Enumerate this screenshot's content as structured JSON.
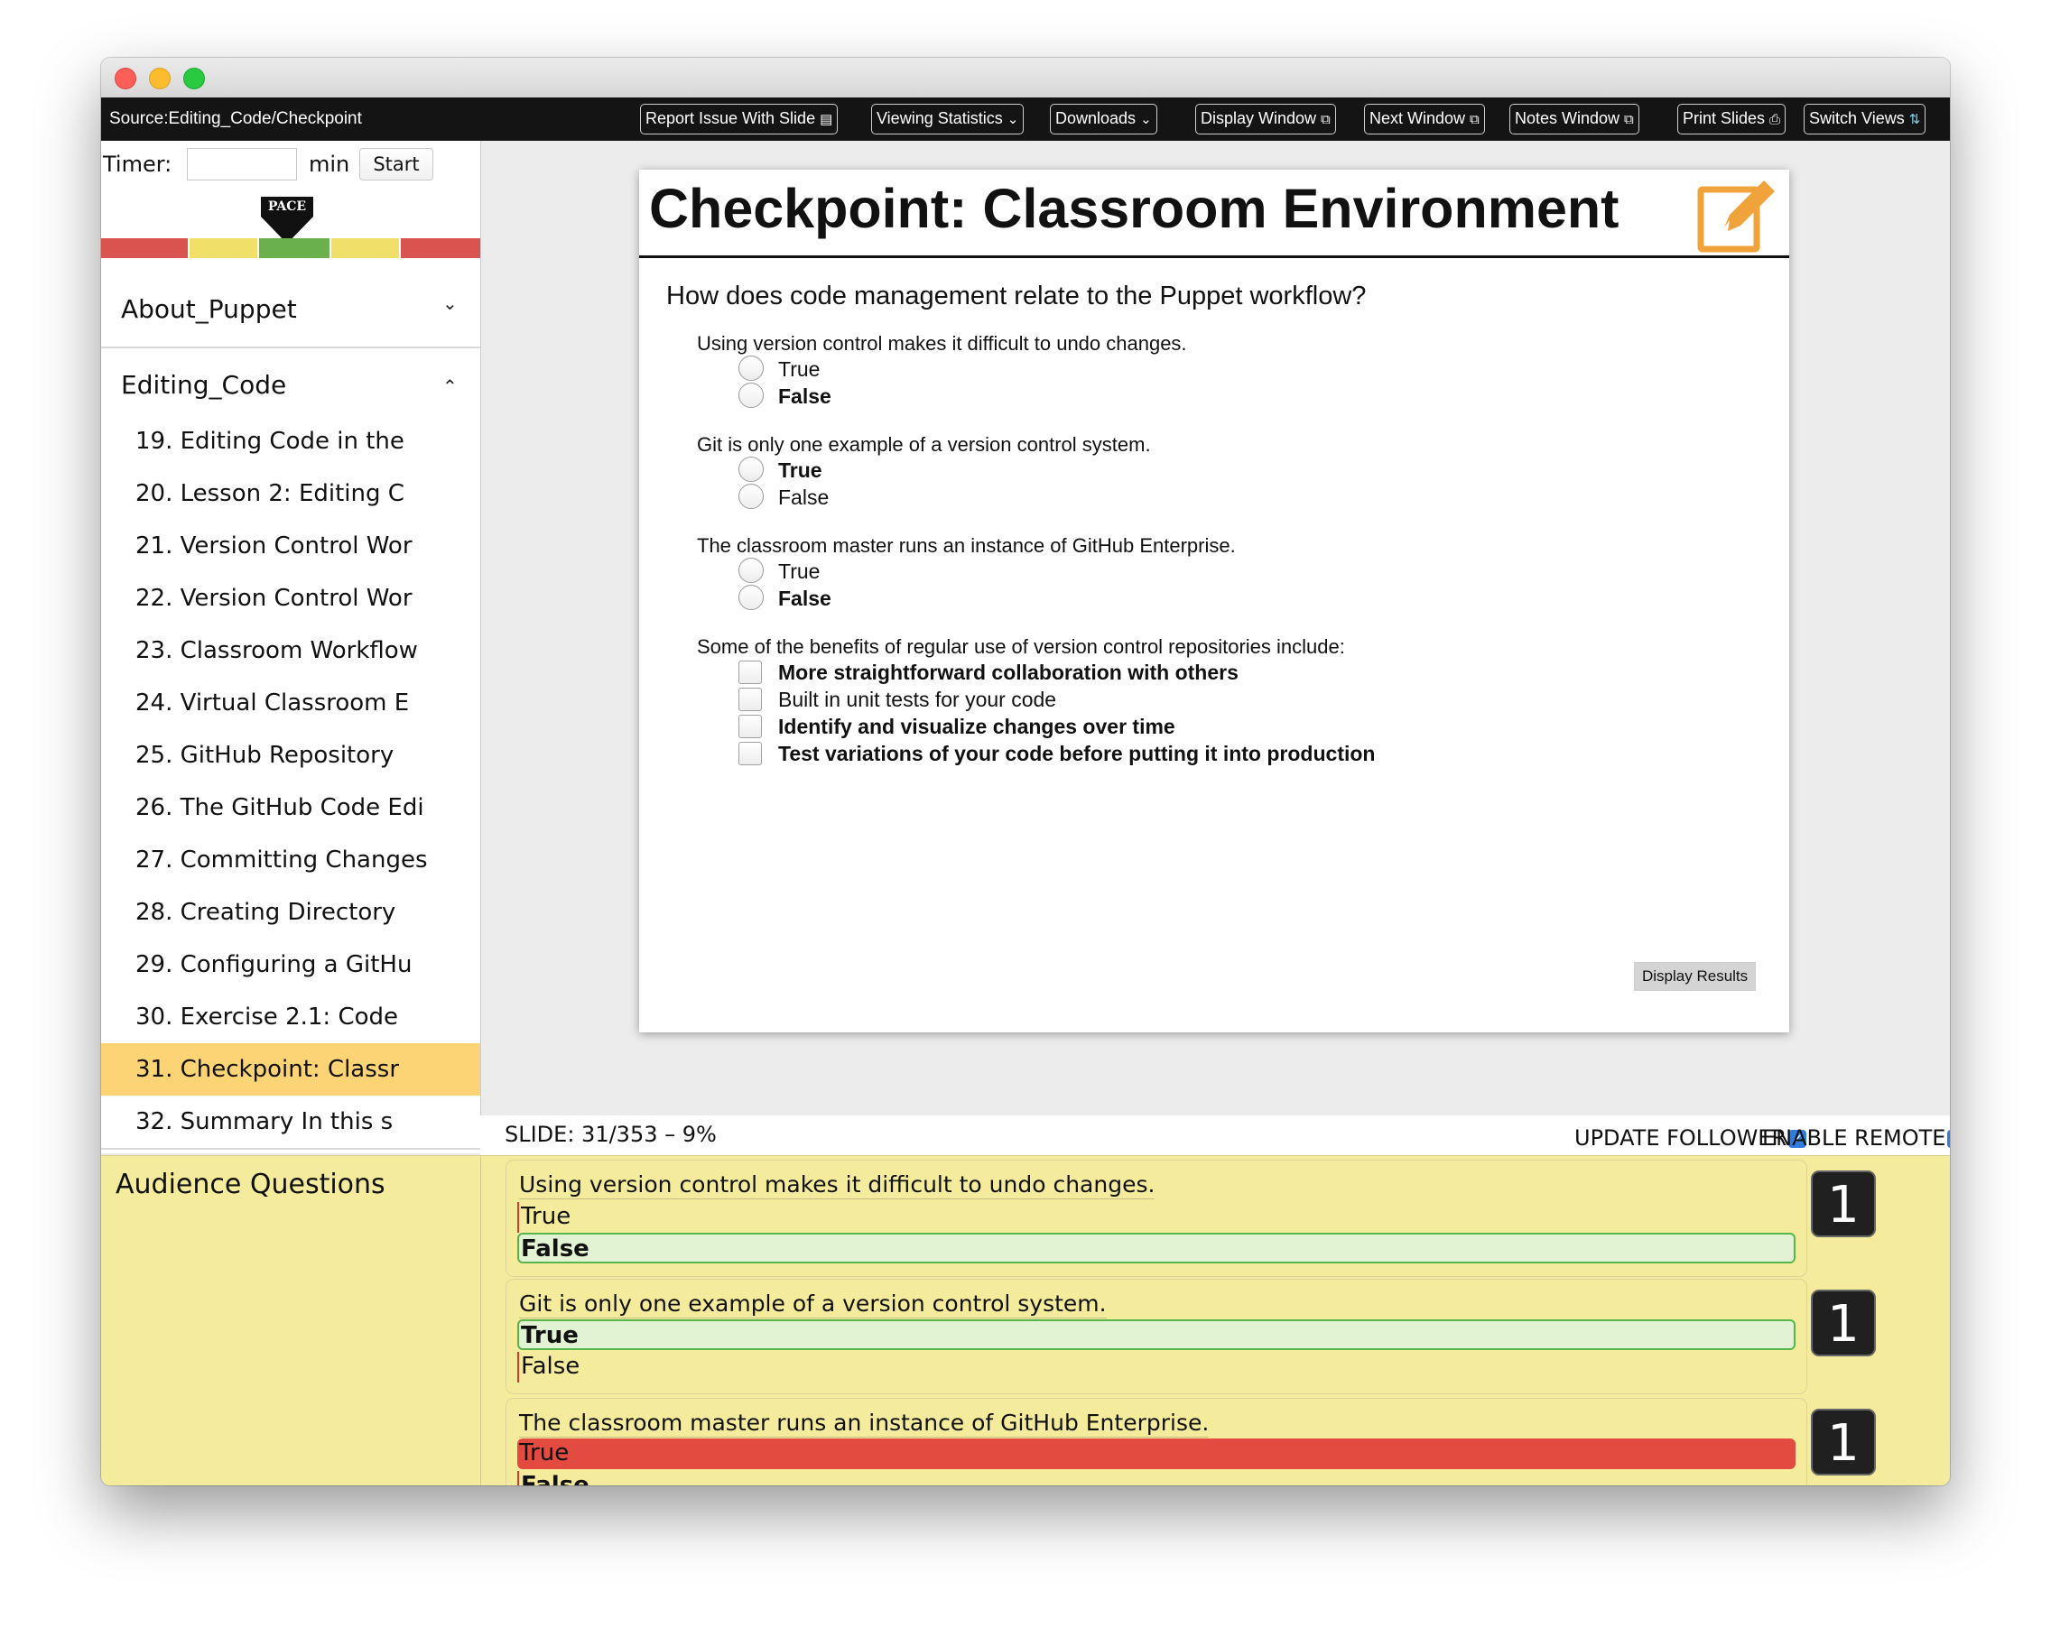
{
  "toolbar": {
    "source": "Source:Editing_Code/Checkpoint",
    "buttons": [
      {
        "label": "Report Issue With Slide",
        "icon": "▤"
      },
      {
        "label": "Viewing Statistics",
        "icon": "⌄"
      },
      {
        "label": "Downloads",
        "icon": "⌄"
      },
      {
        "label": "Display Window",
        "icon": "⧉"
      },
      {
        "label": "Next Window",
        "icon": "⧉"
      },
      {
        "label": "Notes Window",
        "icon": "⧉"
      },
      {
        "label": "Print Slides",
        "icon": "⎙"
      },
      {
        "label": "Switch Views",
        "icon": "⇅"
      }
    ]
  },
  "timer": {
    "label": "Timer:",
    "value": "",
    "unit": "min",
    "start_label": "Start"
  },
  "pace": {
    "label": "PACE",
    "colors": [
      "#d9534f",
      "#f0e06a",
      "#6ab04c",
      "#f0e06a",
      "#d9534f"
    ]
  },
  "sidebar": {
    "sections": [
      {
        "title": "About_Puppet",
        "chevron": "⌄"
      },
      {
        "title": "Editing_Code",
        "chevron": "⌃"
      }
    ],
    "slides": [
      "19. Editing Code in the",
      "20. Lesson 2: Editing C",
      "21. Version Control Wor",
      "22. Version Control Wor",
      "23. Classroom Workflow",
      "24. Virtual Classroom E",
      "25. GitHub Repository",
      "26. The GitHub Code Edi",
      "27. Committing Changes",
      "28. Creating Directory",
      "29. Configuring a GitHu",
      "30. Exercise 2.1: Code",
      "31. Checkpoint: Classr",
      "32. Summary In this s"
    ],
    "active_index": 12
  },
  "slide": {
    "title": "Checkpoint: Classroom Environment",
    "question": "How does code management relate to the Puppet workflow?",
    "items": [
      {
        "q": "Using version control makes it difficult to undo changes.",
        "type": "radio",
        "options": [
          {
            "text": "True",
            "bold": false
          },
          {
            "text": "False",
            "bold": true
          }
        ]
      },
      {
        "q": "Git is only one example of a version control system.",
        "type": "radio",
        "options": [
          {
            "text": "True",
            "bold": true
          },
          {
            "text": "False",
            "bold": false
          }
        ]
      },
      {
        "q": "The classroom master runs an instance of GitHub Enterprise.",
        "type": "radio",
        "options": [
          {
            "text": "True",
            "bold": false
          },
          {
            "text": "False",
            "bold": true
          }
        ]
      },
      {
        "q": "Some of the benefits of regular use of version control repositories include:",
        "type": "checkbox",
        "options": [
          {
            "text": "More straightforward collaboration with others",
            "bold": true
          },
          {
            "text": "Built in unit tests for your code",
            "bold": false
          },
          {
            "text": "Identify and visualize changes over time",
            "bold": true
          },
          {
            "text": "Test variations of your code before putting it into production",
            "bold": true
          }
        ]
      }
    ],
    "display_results": "Display Results"
  },
  "status": {
    "slide_number": "SLIDE: 31/353 – 9%",
    "update_follower": "UPDATE FOLLOWER",
    "enable_remote": "ENABLE REMOTE",
    "check_glyph": "✓"
  },
  "audience": {
    "title": "Audience Questions",
    "cards": [
      {
        "q": "Using version control makes it difficult to undo changes.",
        "count": "1",
        "options": [
          {
            "text": "True",
            "state": "plain"
          },
          {
            "text": "False",
            "state": "correct"
          }
        ]
      },
      {
        "q": "Git is only one example of a version control system.",
        "count": "1",
        "options": [
          {
            "text": "True",
            "state": "correct"
          },
          {
            "text": "False",
            "state": "plain"
          }
        ]
      },
      {
        "q": "The classroom master runs an instance of GitHub Enterprise.",
        "count": "1",
        "options": [
          {
            "text": "True",
            "state": "wrong"
          },
          {
            "text": "False",
            "state": "correct"
          }
        ]
      }
    ]
  }
}
